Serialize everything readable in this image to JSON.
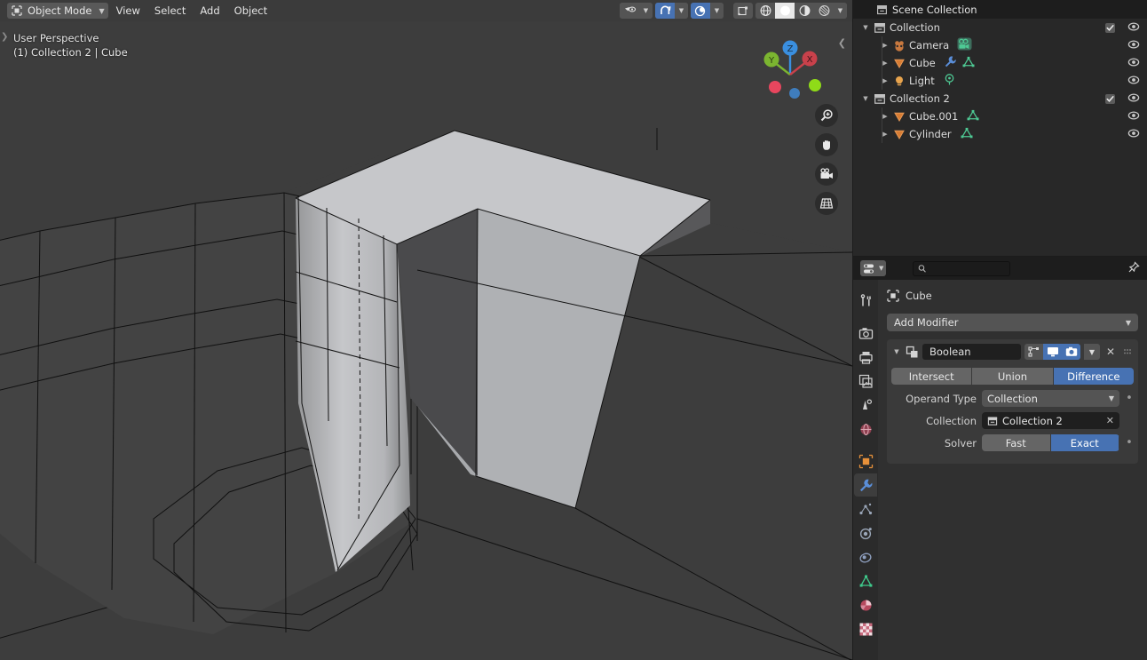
{
  "topbar": {
    "mode": "Object Mode",
    "mode_icon": "object-mode-icon",
    "menus": [
      "View",
      "Select",
      "Add",
      "Object"
    ],
    "right_tools": [
      {
        "name": "visibility-filter",
        "icon": "eye-cursor-icon",
        "active": false
      },
      {
        "name": "snap-toggle",
        "icon": "magnet-snap-icon",
        "active": true
      },
      {
        "name": "proportional-editing",
        "icon": "proportional-edit-icon",
        "active": true
      },
      {
        "name": "transform-orientation",
        "icon": "transform-pivot-icon",
        "active": false
      }
    ],
    "shading_modes": [
      {
        "name": "wireframe",
        "icon": "wireframe-globe-icon",
        "active": false
      },
      {
        "name": "solid",
        "icon": "solid-sphere-icon",
        "active": true
      },
      {
        "name": "material-preview",
        "icon": "material-preview-icon",
        "active": false
      },
      {
        "name": "rendered",
        "icon": "rendered-sphere-icon",
        "active": false
      }
    ]
  },
  "viewport": {
    "perspective_label": "User Perspective",
    "scene_label": "(1) Collection 2 | Cube",
    "gizmo_axes": [
      {
        "label": "Z",
        "color": "#3a8fe0"
      },
      {
        "label": "Y",
        "color": "#7bb530"
      },
      {
        "label": "X",
        "color": "#c8414b"
      }
    ],
    "tools": [
      {
        "name": "zoom-tool",
        "icon": "magnifier-plus-icon"
      },
      {
        "name": "pan-tool",
        "icon": "hand-icon"
      },
      {
        "name": "camera-view-tool",
        "icon": "camera-icon"
      },
      {
        "name": "toggle-perspective-tool",
        "icon": "grid-perspective-icon"
      }
    ],
    "bg_color": "#3d3d3d",
    "face_light": "#c2c3c6",
    "face_mid": "#a8aaad",
    "face_dark": "#5e5e5e"
  },
  "outliner": {
    "header_title": "Scene Collection",
    "header_icon": "collection-icon",
    "rows": [
      {
        "indent": 0,
        "tri": "down",
        "icon": "collection-icon",
        "label": "Collection",
        "extra_icons": [],
        "checkbox": true,
        "eye": true
      },
      {
        "indent": 1,
        "tri": "right",
        "icon": "camera-data-icon",
        "label": "Camera",
        "extra_icons": [
          "camera-object-icon"
        ],
        "checkbox": false,
        "eye": true
      },
      {
        "indent": 1,
        "tri": "right",
        "icon": "mesh-object-icon",
        "label": "Cube",
        "extra_icons": [
          "wrench-modifier-icon",
          "mesh-data-icon"
        ],
        "checkbox": false,
        "eye": true
      },
      {
        "indent": 1,
        "tri": "right",
        "icon": "light-object-icon",
        "label": "Light",
        "extra_icons": [
          "light-data-icon"
        ],
        "checkbox": false,
        "eye": true
      },
      {
        "indent": 0,
        "tri": "down",
        "icon": "collection-icon",
        "label": "Collection 2",
        "extra_icons": [],
        "checkbox": true,
        "eye": true
      },
      {
        "indent": 1,
        "tri": "right",
        "icon": "mesh-object-icon",
        "label": "Cube.001",
        "extra_icons": [
          "mesh-data-icon"
        ],
        "checkbox": false,
        "eye": true
      },
      {
        "indent": 1,
        "tri": "right",
        "icon": "mesh-object-icon",
        "label": "Cylinder",
        "extra_icons": [
          "mesh-data-icon"
        ],
        "checkbox": false,
        "eye": true
      }
    ]
  },
  "properties": {
    "editor_type_icon": "properties-editor-icon",
    "search_placeholder": "",
    "search_value": "",
    "pin_icon": "pin-icon",
    "tabs": [
      {
        "name": "tool",
        "icon": "tool-screwdriver-wrench-icon",
        "active": false
      },
      {
        "name": "render",
        "icon": "render-camera-back-icon",
        "active": false
      },
      {
        "name": "output",
        "icon": "output-printer-icon",
        "active": false
      },
      {
        "name": "view-layer",
        "icon": "view-layer-images-icon",
        "active": false
      },
      {
        "name": "scene",
        "icon": "scene-cone-sphere-icon",
        "active": false
      },
      {
        "name": "world",
        "icon": "world-globe-icon",
        "active": false
      },
      {
        "name": "object",
        "icon": "object-orange-square-icon",
        "active": false
      },
      {
        "name": "modifiers",
        "icon": "wrench-modifier-icon",
        "active": true
      },
      {
        "name": "particles",
        "icon": "particles-icon",
        "active": false
      },
      {
        "name": "physics",
        "icon": "physics-orbit-icon",
        "active": false
      },
      {
        "name": "constraints",
        "icon": "object-constraints-icon",
        "active": false
      },
      {
        "name": "object-data",
        "icon": "mesh-data-green-icon",
        "active": false
      },
      {
        "name": "material",
        "icon": "material-sphere-icon",
        "active": false
      },
      {
        "name": "texture",
        "icon": "texture-checker-icon",
        "active": false
      }
    ],
    "breadcrumb_icon": "object-breadcrumb-icon",
    "breadcrumb_label": "Cube",
    "add_modifier_label": "Add Modifier",
    "modifier": {
      "icon": "boolean-modifier-icon",
      "name": "Boolean",
      "toggles": [
        {
          "name": "edit-mode-display-toggle",
          "icon": "edit-mode-icon",
          "active": false
        },
        {
          "name": "realtime-display-toggle",
          "icon": "monitor-icon",
          "active": true
        },
        {
          "name": "render-display-toggle",
          "icon": "camera-icon",
          "active": true
        }
      ],
      "dropdown_icon": "chevron-down-icon",
      "close_icon": "x-icon",
      "grip_icon": "drag-grip-icon",
      "operations": [
        {
          "label": "Intersect",
          "active": false
        },
        {
          "label": "Union",
          "active": false
        },
        {
          "label": "Difference",
          "active": true
        }
      ],
      "rows": [
        {
          "label": "Operand Type",
          "type": "dropdown",
          "value": "Collection",
          "dot": true
        },
        {
          "label": "Collection",
          "type": "id-field",
          "value": "Collection 2",
          "icon": "collection-icon",
          "dot": false
        },
        {
          "label": "Solver",
          "type": "segmented",
          "options": [
            {
              "label": "Fast",
              "active": false
            },
            {
              "label": "Exact",
              "active": true
            }
          ],
          "dot": true
        }
      ]
    }
  },
  "colors": {
    "accent_blue": "#4772b3",
    "panel_bg": "#303030",
    "header_bg": "#1d1d1d",
    "outliner_bg": "#282828",
    "topbar_bg": "#3b3b3b",
    "orange": "#e8913a",
    "green": "#4ec994"
  }
}
